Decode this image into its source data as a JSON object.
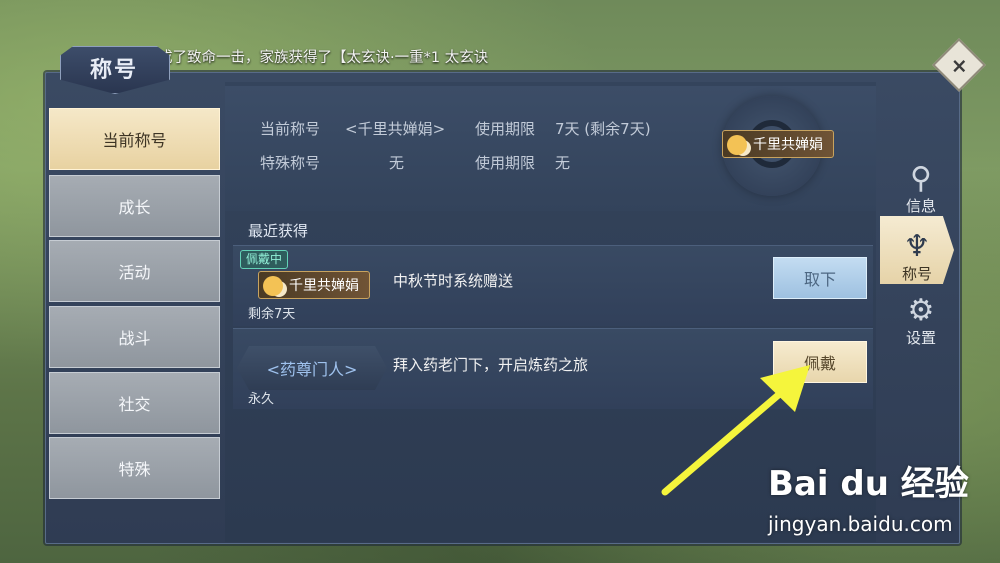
{
  "broadcast": "秦丙】造成了致命一击，家族获得了【太玄诀·一重*1 太玄诀",
  "window": {
    "title": "称号",
    "close_icon": "×"
  },
  "left_tabs": [
    {
      "label": "当前称号",
      "active": true
    },
    {
      "label": "成长"
    },
    {
      "label": "活动"
    },
    {
      "label": "战斗"
    },
    {
      "label": "社交"
    },
    {
      "label": "特殊"
    }
  ],
  "current": {
    "label_current": "当前称号",
    "current_value": "<千里共婵娟>",
    "label_limit": "使用期限",
    "limit_value": "7天 (剩余7天)",
    "label_special": "特殊称号",
    "special_value": "无",
    "label_limit2": "使用期限",
    "limit2_value": "无",
    "badge_text": "千里共婵娟"
  },
  "recent": {
    "heading": "最近获得",
    "rows": [
      {
        "tag": "佩戴中",
        "badge": "千里共婵娟",
        "remaining": "剩余7天",
        "desc": "中秋节时系统赠送",
        "button": "取下"
      },
      {
        "title": "<药尊门人>",
        "remaining": "永久",
        "desc": "拜入药老门下，开启炼药之旅",
        "button": "佩戴"
      }
    ]
  },
  "right_tabs": [
    {
      "label": "信息",
      "icon": "scroll-icon",
      "glyph": "⚲"
    },
    {
      "label": "称号",
      "icon": "crest-icon",
      "glyph": "♆",
      "active": true
    },
    {
      "label": "设置",
      "icon": "gear-icon",
      "glyph": "⚙"
    }
  ],
  "watermark": {
    "logo": "Bai du 经验",
    "url": "jingyan.baidu.com"
  },
  "colors": {
    "arrow": "#f5f53c",
    "accent_gold": "#c8a35f",
    "button_blue": "#a8c9e8"
  }
}
